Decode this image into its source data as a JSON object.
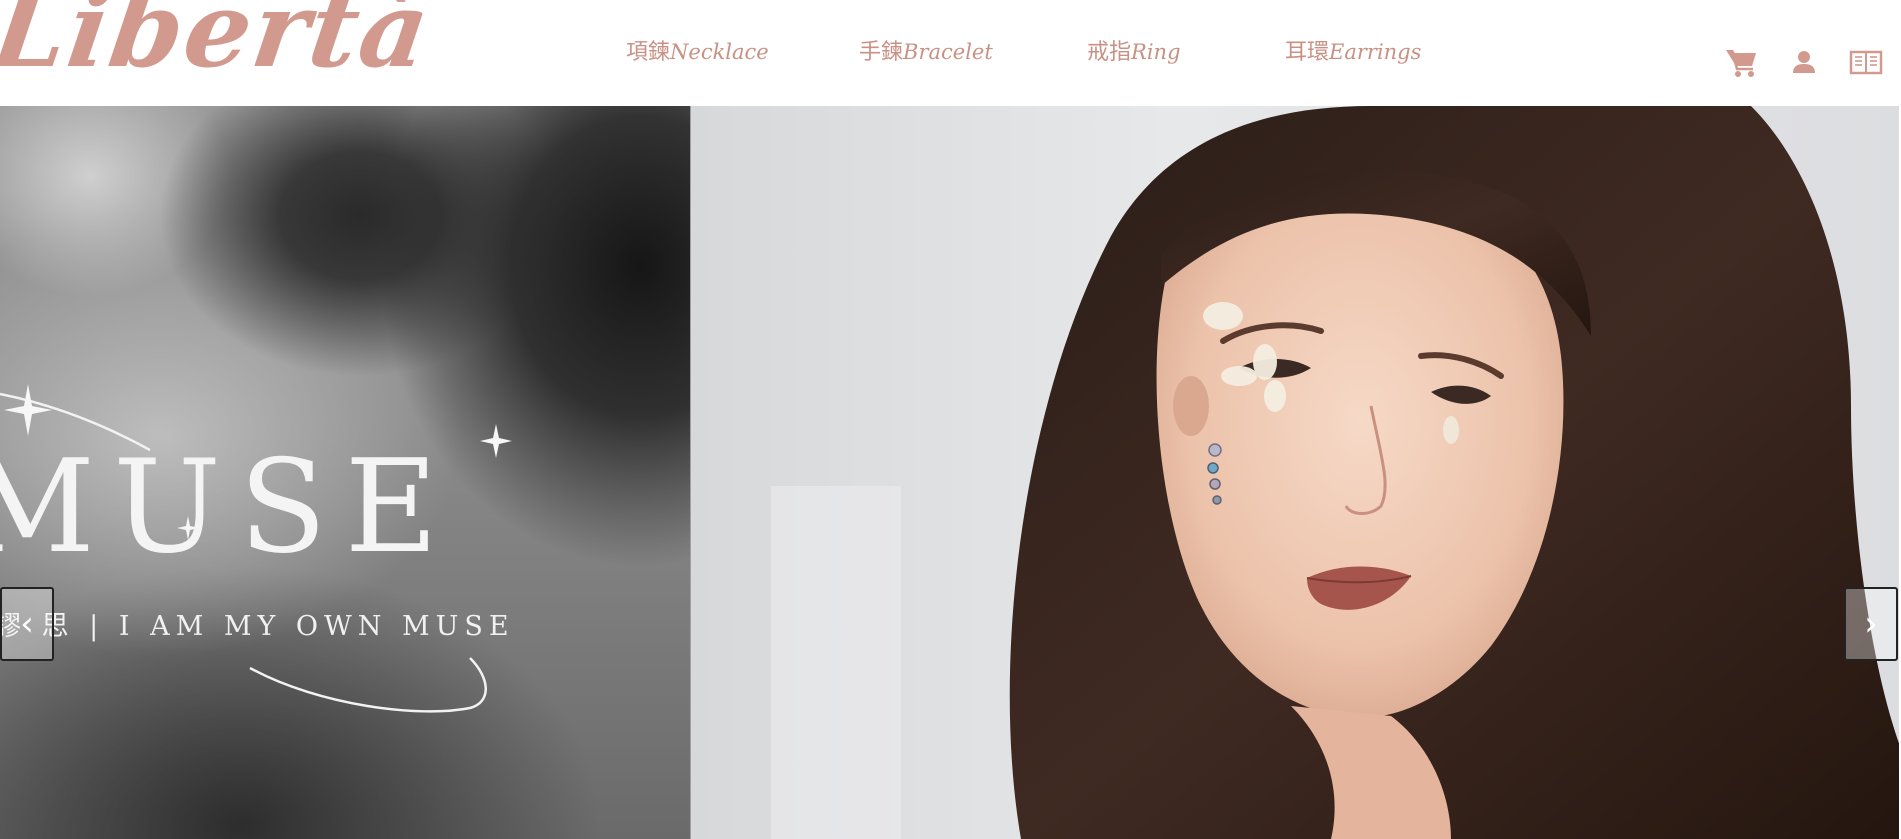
{
  "brand": {
    "logo_text": "Libertà",
    "color": "#d29a8e"
  },
  "nav": {
    "items": [
      {
        "zh": "項鍊",
        "en": "Necklace"
      },
      {
        "zh": "手鍊",
        "en": "Bracelet"
      },
      {
        "zh": "戒指",
        "en": "Ring"
      },
      {
        "zh": "耳環",
        "en": "Earrings"
      }
    ],
    "color": "#c99184"
  },
  "header_icons": [
    "cart-icon",
    "user-icon",
    "menu-book-icon"
  ],
  "hero": {
    "left_slide": {
      "title": "MUSE",
      "tagline": "謬 思 | I AM MY OWN MUSE"
    },
    "prev_arrow": "‹",
    "next_arrow": "›"
  }
}
